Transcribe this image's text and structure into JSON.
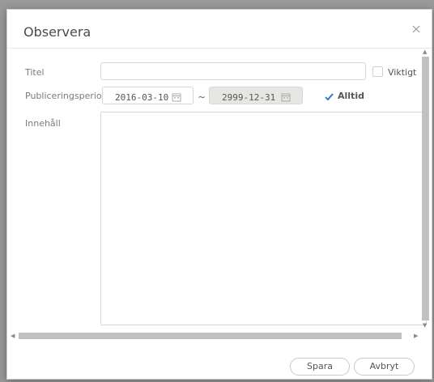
{
  "dialog": {
    "title": "Observera",
    "close_icon": "close-icon"
  },
  "form": {
    "title_label": "Titel",
    "title_value": "",
    "important_label": "Viktigt",
    "important_checked": false,
    "period_label": "Publiceringsperiod",
    "start_date": "2016-03-10",
    "separator": "~",
    "end_date": "2999-12-31",
    "always_label": "Alltid",
    "always_checked": true,
    "content_label": "Innehåll",
    "content_value": ""
  },
  "buttons": {
    "save_label": "Spara",
    "cancel_label": "Avbryt"
  },
  "colors": {
    "check_accent": "#2a6fc9",
    "disabled_field": "#e6e6e2"
  }
}
